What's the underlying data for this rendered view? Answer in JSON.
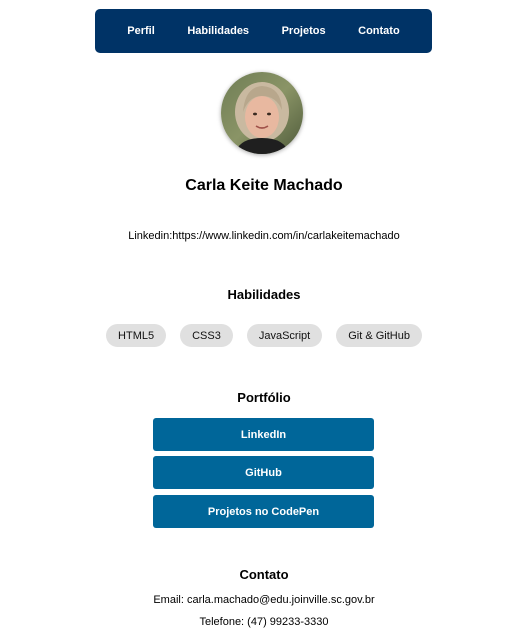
{
  "nav": {
    "items": [
      {
        "label": "Perfil"
      },
      {
        "label": "Habilidades"
      },
      {
        "label": "Projetos"
      },
      {
        "label": "Contato"
      }
    ]
  },
  "profile": {
    "name": "Carla Keite Machado",
    "linkedin_line": "Linkedin:https://www.linkedin.com/in/carlakeitemachado"
  },
  "skills": {
    "title": "Habilidades",
    "items": [
      "HTML5",
      "CSS3",
      "JavaScript",
      "Git & GitHub"
    ]
  },
  "portfolio": {
    "title": "Portfólio",
    "buttons": [
      "LinkedIn",
      "GitHub",
      "Projetos no CodePen"
    ]
  },
  "contact": {
    "title": "Contato",
    "email": "Email: carla.machado@edu.joinville.sc.gov.br",
    "phone": "Telefone: (47) 99233-3330"
  },
  "colors": {
    "nav_bg": "#003366",
    "button_bg": "#006699",
    "pill_bg": "#e0e0e0"
  }
}
